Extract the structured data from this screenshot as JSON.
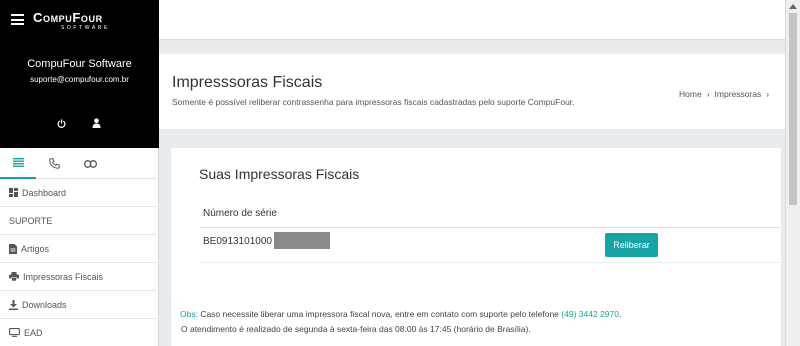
{
  "brand": {
    "name": "CompuFour",
    "tagline": "SOFTWARE"
  },
  "profile": {
    "name": "CompuFour Software",
    "email": "suporte@compufour.com.br"
  },
  "sidebar": {
    "tabs": [
      "list-icon",
      "phone-icon",
      "link-icon"
    ],
    "items": [
      {
        "label": "Dashboard",
        "icon": "dashboard-icon"
      },
      {
        "label": "SUPORTE"
      },
      {
        "label": "Artigos",
        "icon": "document-icon"
      },
      {
        "label": "Impressoras Fiscais",
        "icon": "printer-icon"
      },
      {
        "label": "Downloads",
        "icon": "download-icon"
      },
      {
        "label": "EAD",
        "icon": "monitor-icon"
      }
    ]
  },
  "page": {
    "title": "Impresssoras Fiscais",
    "subtitle": "Somente é possível reliberar contrassenha para impressoras fiscais cadastradas pelo suporte CompuFour.",
    "breadcrumb": [
      "Home",
      "Impressoras"
    ]
  },
  "card": {
    "title": "Suas Impressoras Fiscais",
    "column_header": "Número de série",
    "rows": [
      {
        "serial": "BE0913101000",
        "action": "Reliberar"
      }
    ]
  },
  "obs": {
    "label": "Obs:",
    "text1": " Caso necessite liberar uma impressora fiscal nova, entre em contato com suporte pelo telefone ",
    "phone": "(49) 3442 2970",
    "text1_end": ".",
    "text2": "O atendimento é realizado de segunda à sexta-feira das 08:00 às 17:45 (horário de Brasília)."
  },
  "colors": {
    "accent": "#17a2a6",
    "sidebar_dark": "#000000"
  }
}
